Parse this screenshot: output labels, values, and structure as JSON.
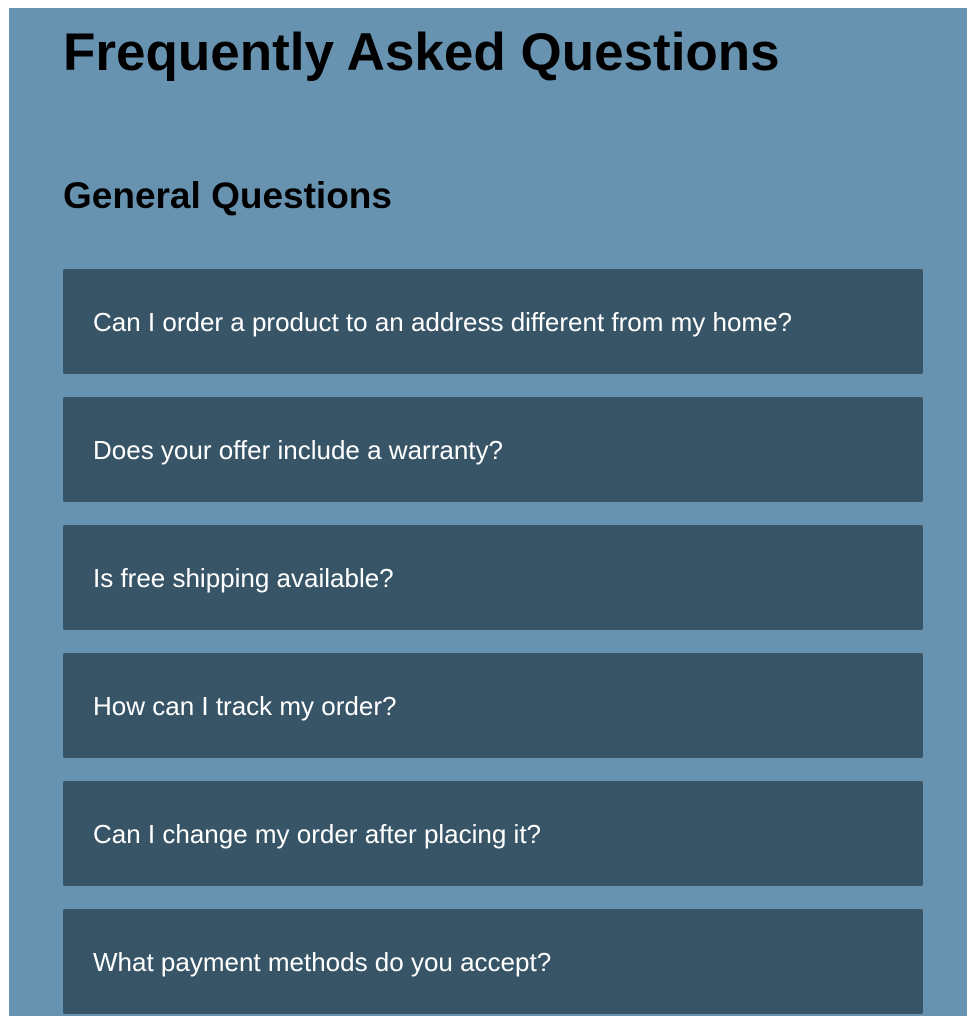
{
  "page": {
    "title": "Frequently Asked Questions"
  },
  "section": {
    "title": "General Questions"
  },
  "faq": [
    {
      "question": "Can I order a product to an address different from my home?"
    },
    {
      "question": "Does your offer include a warranty?"
    },
    {
      "question": "Is free shipping available?"
    },
    {
      "question": "How can I track my order?"
    },
    {
      "question": "Can I change my order after placing it?"
    },
    {
      "question": "What payment methods do you accept?"
    }
  ],
  "colors": {
    "page_background": "#6793b0",
    "item_background": "#375566",
    "item_text": "#ffffff",
    "heading_text": "#000000"
  }
}
